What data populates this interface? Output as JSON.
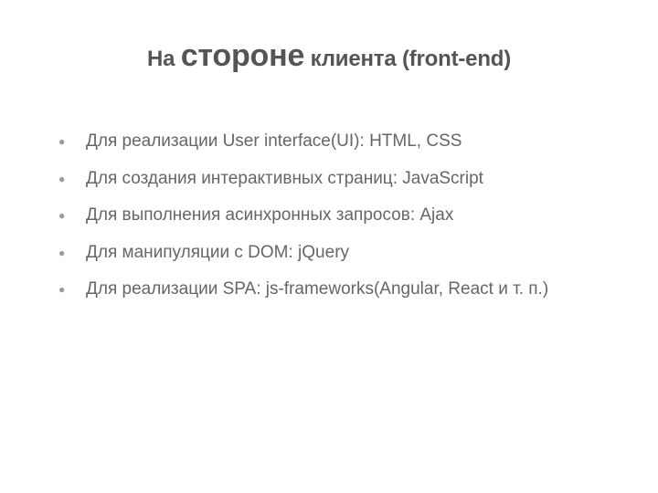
{
  "slide": {
    "title_prefix": "На ",
    "title_emph": "стороне",
    "title_suffix": " клиента (front-end)",
    "bullets": [
      "Для реализации User interface(UI): HTML, CSS",
      "Для создания интерактивных страниц: JavaScript",
      "Для выполнения асинхронных запросов: Ajax",
      "Для манипуляции с DOM: jQuery",
      "Для реализации SPA: js-frameworks(Angular, React и т. п.)"
    ]
  }
}
